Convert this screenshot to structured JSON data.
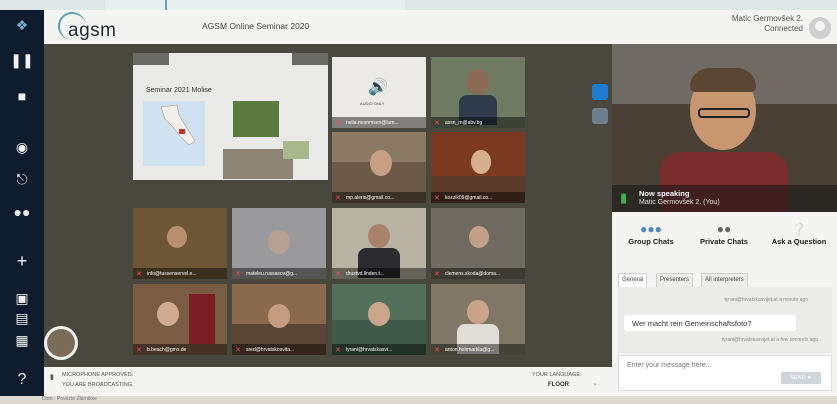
{
  "header": {
    "logo_text": "agsm",
    "seminar_title": "AGSM Online Seminar 2020",
    "user_name": "Matic Germovšek 2.",
    "connection_status": "Connected"
  },
  "toolbar": {
    "icons": [
      "logo-icon",
      "pause-icon",
      "stop-icon",
      "speaker-icon",
      "headset-icon",
      "people-icon",
      "plus-icon",
      "screen-icon",
      "layout-icon",
      "grid-icon",
      "help-icon"
    ]
  },
  "slide": {
    "title": "Seminar 2021 Molise"
  },
  "audio_tile": {
    "sub_label": "AUDIO ONLY"
  },
  "tiles": [
    {
      "name": "nelia.mommsen@lum..."
    },
    {
      "name": "assn_m@abv.bg"
    },
    {
      "name": "mp.aleris@gmail.co..."
    },
    {
      "name": "kozzik09@gmail.co..."
    },
    {
      "name": "info@tussenservel.e..."
    },
    {
      "name": "mateleu.russasov@g..."
    },
    {
      "name": "drustvd.linden.t..."
    },
    {
      "name": "clemens.skoda@doma..."
    },
    {
      "name": "b.beach@gmx.de"
    },
    {
      "name": "sred@hrvatskosvita..."
    },
    {
      "name": "lyrani@hrvatskasvi..."
    },
    {
      "name": "anton.hohmarkla@g..."
    }
  ],
  "bottombar": {
    "mic_status": "MICROPHONE APPROVED.",
    "broadcast_status": "YOU ARE BROADCASTING.",
    "language_label": "YOUR LANGUAGE:",
    "language_value": "FLOOR"
  },
  "right_panel": {
    "now_speaking_label": "Now speaking",
    "now_speaking_name": "Matic Germovšek 2. (You)",
    "tabs": [
      {
        "label": "Group Chats"
      },
      {
        "label": "Private Chats"
      },
      {
        "label": "Ask a Question"
      }
    ],
    "sub_tabs": [
      "General",
      "Presenters",
      "All interpreters"
    ],
    "chat": {
      "meta1": "tyrani@hrvatskasvijet.at  a minute ago",
      "message": "Wer macht rein Gemeinschaftsfoto?",
      "meta2": "tyrani@hrvatskasvijet.at  a few seconds ago"
    },
    "input_placeholder": "Enter your message here...",
    "send_label": "SEND"
  },
  "bottom_strip": {
    "text": "Dom · Povezte Zbirnikke"
  },
  "colors": {
    "toolbar_bg": "#0f1c2d",
    "stage_bg": "#48483f",
    "accent": "#4f88c2",
    "muted_mic": "#ff4d4d",
    "speaking_mic": "#3bb34a"
  }
}
